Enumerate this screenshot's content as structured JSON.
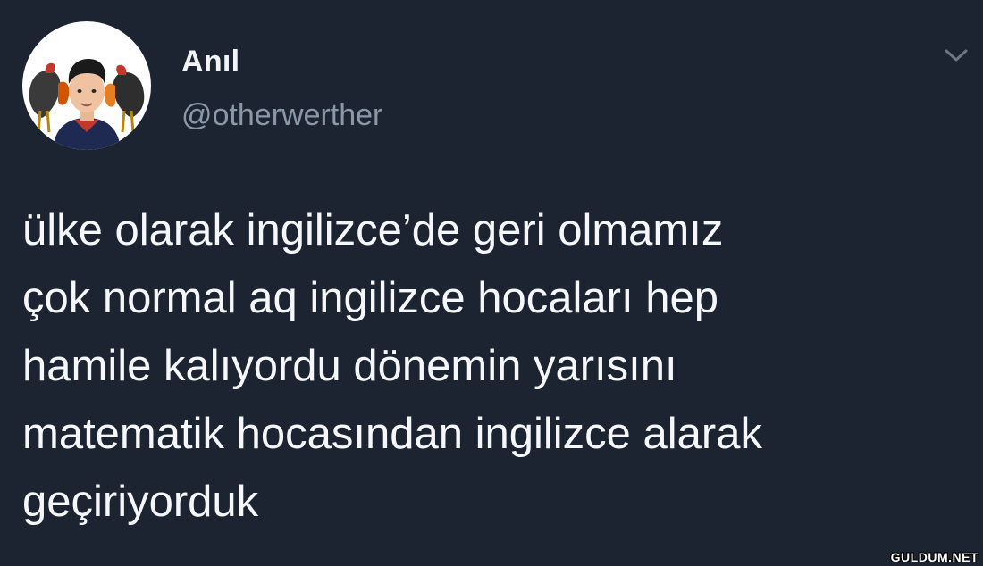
{
  "tweet": {
    "user": {
      "display_name": "Anıl",
      "handle": "@otherwerther"
    },
    "menu_icon": "chevron-down-icon",
    "text_lines": [
      "ülke olarak ingilizce’de geri olmamız",
      "çok normal aq ingilizce hocaları hep",
      "hamile kalıyordu dönemin yarısını",
      "matematik hocasından ingilizce alarak",
      "geçiriyorduk"
    ]
  },
  "watermark": "GULDUM.NET",
  "colors": {
    "background": "#1c2431",
    "text": "#f5f7fa",
    "handle": "#8b98a8",
    "chevron": "#6b7787"
  }
}
